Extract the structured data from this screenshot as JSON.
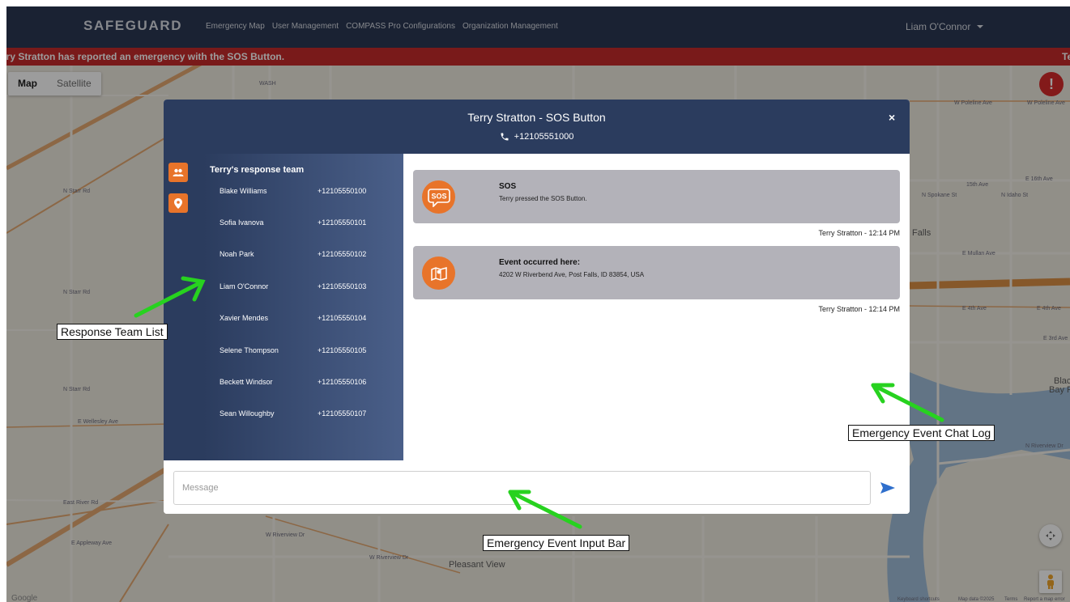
{
  "app": {
    "brand": "SAFEGUARD",
    "nav_links": [
      "Emergency Map",
      "User Management",
      "COMPASS Pro Configurations",
      "Organization Management"
    ],
    "user_name": "Liam O'Connor"
  },
  "alert_banner": {
    "text": "rry Stratton has reported an emergency with the SOS Button.",
    "overflow_text": "Te"
  },
  "map": {
    "toggle": [
      "Map",
      "Satellite"
    ],
    "place_labels": [
      "Pleasant View",
      "Falls",
      "Blac",
      "Bay P"
    ],
    "street_labels": [
      "W Poleline Ave",
      "W Poleline Ave",
      "15th Ave",
      "E 16th Ave",
      "E Mullan Ave",
      "E 4th Ave",
      "E 4th Ave",
      "E 3rd Ave",
      "W Riverview Dr",
      "E Wellesley Ave",
      "East River Rd",
      "E Appleway Ave",
      "W Riverview Dr",
      "N Riverview Dr",
      "WASH",
      "N Spokane St",
      "N Idaho St",
      "N Starr Rd",
      "N Starr Rd",
      "N Starr Rd"
    ],
    "footer": [
      "Google",
      "Keyboard shortcuts",
      "Map data ©2025",
      "Terms",
      "Report a map error"
    ],
    "colors": {
      "land": "#ece8dd",
      "road": "#e3a469",
      "water": "#9bbbd8",
      "highway": "#d98a3c"
    }
  },
  "modal": {
    "title": "Terry Stratton - SOS Button",
    "phone": "+12105551000",
    "close_glyph": "×",
    "team_title": "Terry's response team",
    "team": [
      {
        "name": "Blake Williams",
        "phone": "+12105550100"
      },
      {
        "name": "Sofia Ivanova",
        "phone": "+12105550101"
      },
      {
        "name": "Noah Park",
        "phone": "+12105550102"
      },
      {
        "name": "Liam O'Connor",
        "phone": "+12105550103"
      },
      {
        "name": "Xavier Mendes",
        "phone": "+12105550104"
      },
      {
        "name": "Selene Thompson",
        "phone": "+12105550105"
      },
      {
        "name": "Beckett Windsor",
        "phone": "+12105550106"
      },
      {
        "name": "Sean Willoughby",
        "phone": "+12105550107"
      }
    ],
    "messages": [
      {
        "icon": "sos-icon",
        "badge": "SOS",
        "title": "SOS",
        "text": "Terry pressed the SOS Button.",
        "stamp": "Terry Stratton - 12:14 PM"
      },
      {
        "icon": "map-icon",
        "title": "Event occurred here:",
        "text": "4202 W Riverbend Ave, Post Falls, ID 83854, USA",
        "stamp": "Terry Stratton - 12:14 PM"
      }
    ],
    "input_placeholder": "Message",
    "accent": "#e8742a",
    "header_color": "#2b3c5e",
    "send_color": "#2f6fcc"
  },
  "annotations": {
    "team_list": "Response Team List",
    "chat_log": "Emergency Event Chat Log",
    "input_bar": "Emergency Event Input Bar",
    "arrow_color": "#27d21f"
  },
  "icons": [
    "phone-icon",
    "team-icon",
    "location-pin-icon",
    "send-icon",
    "alert-icon",
    "recenter-icon",
    "pegman-icon"
  ]
}
